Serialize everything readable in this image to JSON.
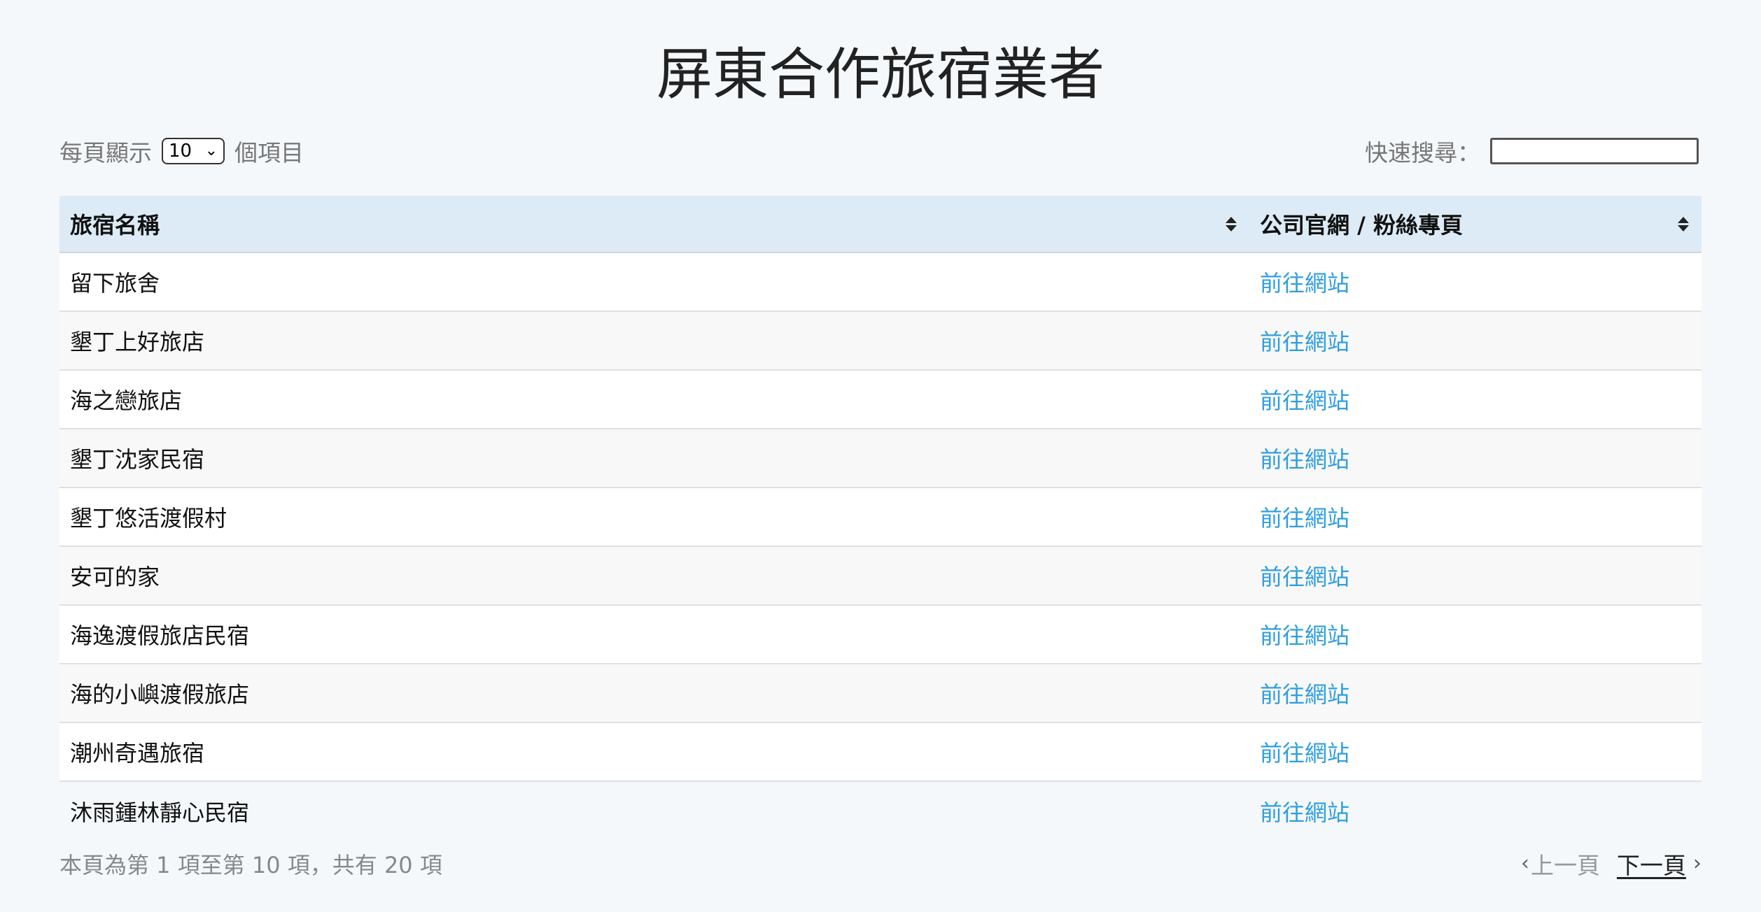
{
  "page": {
    "title": "屏東合作旅宿業者"
  },
  "length_control": {
    "prefix": "每頁顯示",
    "selected": "10",
    "suffix": "個項目",
    "arrow_icon": "chevron-down-icon"
  },
  "search": {
    "label": "快速搜尋：",
    "value": "",
    "placeholder": ""
  },
  "table": {
    "headers": [
      "旅宿名稱",
      "公司官網 / 粉絲專頁"
    ],
    "rows": [
      {
        "name": "留下旅舍",
        "link": "前往網站"
      },
      {
        "name": "墾丁上好旅店",
        "link": "前往網站"
      },
      {
        "name": "海之戀旅店",
        "link": "前往網站"
      },
      {
        "name": "墾丁沈家民宿",
        "link": "前往網站"
      },
      {
        "name": "墾丁悠活渡假村",
        "link": "前往網站"
      },
      {
        "name": "安可的家",
        "link": "前往網站"
      },
      {
        "name": "海逸渡假旅店民宿",
        "link": "前往網站"
      },
      {
        "name": "海的小嶼渡假旅店",
        "link": "前往網站"
      },
      {
        "name": "潮州奇遇旅宿",
        "link": "前往網站"
      },
      {
        "name": "沐雨鍾林靜心民宿",
        "link": "前往網站"
      }
    ]
  },
  "info": {
    "text": "本頁為第 1 項至第 10 項，共有 20 項"
  },
  "pagination": {
    "prev_label": "上一頁",
    "next_label": "下一頁",
    "prev_icon": "chevron-left-icon",
    "next_icon": "chevron-right-icon"
  },
  "colors": {
    "background": "#f5f8fb",
    "header_bg": "#dcebf5",
    "link": "#2e9ee0"
  }
}
